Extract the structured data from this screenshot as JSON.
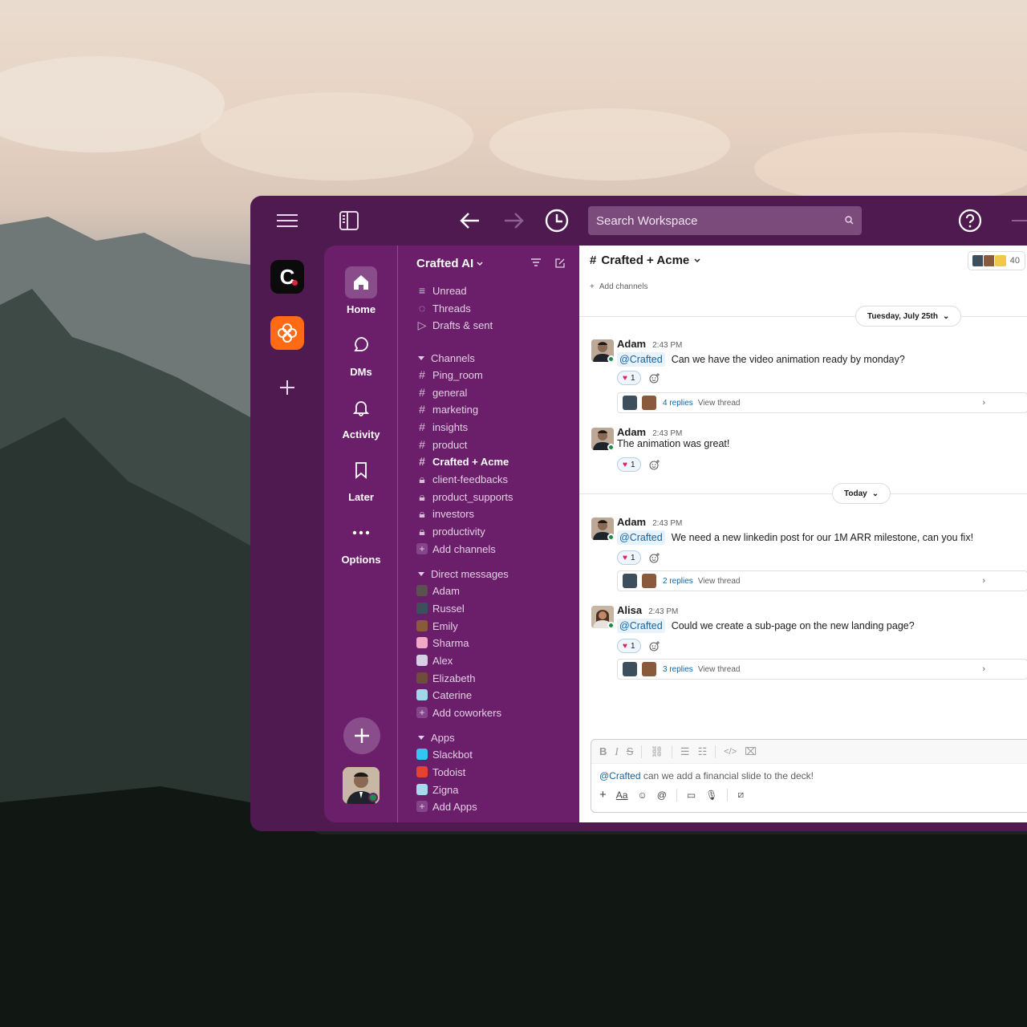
{
  "colors": {
    "aubergine": "#4e1a4f",
    "sidebar": "#6b1f6b",
    "accent_link": "#1264a3",
    "online": "#1f8a4c",
    "brand_orange": "#ff6a14"
  },
  "topbar": {
    "search_placeholder": "Search Workspace",
    "icons": [
      "menu-icon",
      "sidebar-toggle-icon",
      "back-arrow-icon",
      "forward-arrow-icon",
      "history-icon",
      "search-icon",
      "help-icon"
    ]
  },
  "workspaces": {
    "crafted_letter": "C"
  },
  "nav": {
    "home": "Home",
    "dms": "DMs",
    "activity": "Activity",
    "later": "Later",
    "options": "Options"
  },
  "sidebar": {
    "workspace_name": "Crafted AI",
    "top_items": [
      "Unread",
      "Threads",
      "Drafts & sent"
    ],
    "channels_header": "Channels",
    "channels": [
      {
        "name": "Ping_room",
        "private": false
      },
      {
        "name": "general",
        "private": false
      },
      {
        "name": "marketing",
        "private": false
      },
      {
        "name": "insights",
        "private": false
      },
      {
        "name": "product",
        "private": false
      },
      {
        "name": "Crafted + Acme",
        "private": false,
        "active": true
      },
      {
        "name": "client-feedbacks",
        "private": true
      },
      {
        "name": "product_supports",
        "private": true
      },
      {
        "name": "investors",
        "private": true
      },
      {
        "name": "productivity",
        "private": true
      }
    ],
    "add_channels": "Add channels",
    "dm_header": "Direct messages",
    "dms": [
      {
        "name": "Adam",
        "color": "#5a5150"
      },
      {
        "name": "Russel",
        "color": "#3d4f5c"
      },
      {
        "name": "Emily",
        "color": "#8a5a3c"
      },
      {
        "name": "Sharma",
        "color": "#f2a9c5"
      },
      {
        "name": "Alex",
        "color": "#d7cfe6"
      },
      {
        "name": "Elizabeth",
        "color": "#6e4e3a"
      },
      {
        "name": "Caterine",
        "color": "#9fd6ea"
      }
    ],
    "add_coworkers": "Add coworkers",
    "apps_header": "Apps",
    "apps": [
      {
        "name": "Slackbot",
        "color": "#36c5f0"
      },
      {
        "name": "Todoist",
        "color": "#e44332"
      },
      {
        "name": "Zigna",
        "color": "#a8d8ea"
      }
    ],
    "add_apps": "Add Apps"
  },
  "channel": {
    "title": "Crafted + Acme",
    "member_count": "40",
    "add_channels": "Add channels",
    "date_old": "Tuesday, July 25th",
    "date_today": "Today"
  },
  "messages": [
    {
      "author": "Adam",
      "time": "2:43 PM",
      "mention": "@Crafted",
      "text": "Can we have the video animation ready by monday?",
      "reaction_count": "1",
      "replies": "4 replies",
      "view": "View thread"
    },
    {
      "author": "Adam",
      "time": "2:43 PM",
      "mention": "",
      "text": "The animation was great!",
      "reaction_count": "1"
    },
    {
      "author": "Adam",
      "time": "2:43 PM",
      "mention": "@Crafted",
      "text": "We need a new linkedin post for our 1M ARR milestone, can you fix!",
      "reaction_count": "1",
      "replies": "2 replies",
      "view": "View thread"
    },
    {
      "author": "Alisa",
      "time": "2:43 PM",
      "mention": "@Crafted",
      "text": "Could we create a sub-page on the new landing page?",
      "reaction_count": "1",
      "replies": "3 replies",
      "view": "View thread"
    }
  ],
  "composer": {
    "mention": "@Crafted",
    "text": " can we add a financial slide to the deck!",
    "format_icons": [
      "bold-icon",
      "italic-icon",
      "strike-icon",
      "link-icon",
      "ordered-list-icon",
      "bullet-list-icon",
      "code-icon",
      "code-block-icon"
    ],
    "tool_icons": [
      "plus-icon",
      "text-format-icon",
      "emoji-icon",
      "mention-icon",
      "video-icon",
      "mic-icon",
      "slash-icon"
    ]
  }
}
